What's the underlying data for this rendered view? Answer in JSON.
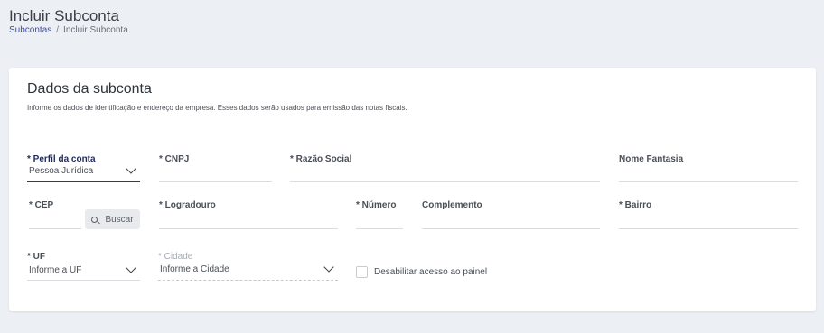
{
  "page": {
    "title": "Incluir Subconta",
    "breadcrumb": {
      "link": "Subcontas",
      "separator": "/",
      "current": "Incluir Subconta"
    }
  },
  "card": {
    "title": "Dados da subconta",
    "subtitle": "Informe os dados de identificação e endereço da empresa. Esses dados serão usados para emissão das notas fiscais."
  },
  "form": {
    "perfil": {
      "label": "* Perfil da conta",
      "value": "Pessoa Jurídica"
    },
    "cnpj": {
      "label": "* CNPJ"
    },
    "razao_social": {
      "label": "* Razão Social"
    },
    "nome_fantasia": {
      "label": "Nome Fantasia"
    },
    "cep": {
      "label": "* CEP",
      "button": "Buscar"
    },
    "logradouro": {
      "label": "* Logradouro"
    },
    "numero": {
      "label": "* Número"
    },
    "complemento": {
      "label": "Complemento"
    },
    "bairro": {
      "label": "* Bairro"
    },
    "uf": {
      "label": "* UF",
      "placeholder": "Informe a UF"
    },
    "cidade": {
      "label": "* Cidade",
      "placeholder": "Informe a Cidade",
      "disabled": true
    },
    "desabilitar_acesso": {
      "label": "Desabilitar acesso ao painel",
      "checked": false
    }
  },
  "colors": {
    "accent": "#243a7a",
    "link": "#3d4fa8",
    "background": "#eceff3"
  }
}
